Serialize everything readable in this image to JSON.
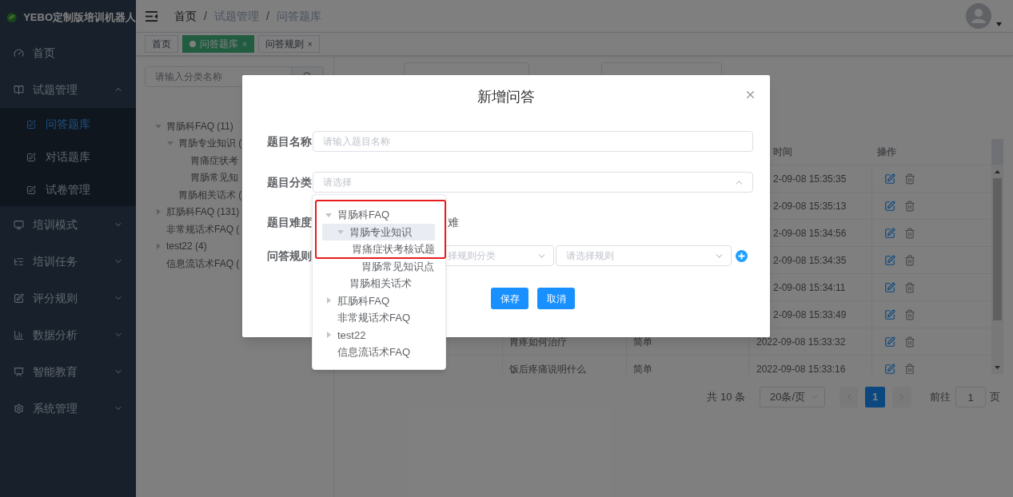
{
  "sidebar": {
    "title": "YEBO定制版培训机器人",
    "items": [
      {
        "label": "首页",
        "kind": "link",
        "selected": false
      },
      {
        "label": "试题管理",
        "kind": "group",
        "selected": false,
        "expanded": true,
        "children": [
          {
            "label": "问答题库",
            "selected": true
          },
          {
            "label": "对话题库",
            "selected": false
          },
          {
            "label": "试卷管理",
            "selected": false
          }
        ]
      },
      {
        "label": "培训模式",
        "kind": "group",
        "selected": false,
        "expanded": false
      },
      {
        "label": "培训任务",
        "kind": "group",
        "selected": false,
        "expanded": false
      },
      {
        "label": "评分规则",
        "kind": "group",
        "selected": false,
        "expanded": false
      },
      {
        "label": "数据分析",
        "kind": "group",
        "selected": false,
        "expanded": false
      },
      {
        "label": "智能教育",
        "kind": "group",
        "selected": false,
        "expanded": false
      },
      {
        "label": "系统管理",
        "kind": "group",
        "selected": false,
        "expanded": false
      }
    ]
  },
  "navbar": {
    "breadcrumb": [
      "首页",
      "试题管理",
      "问答题库"
    ],
    "separator": "/"
  },
  "tags": [
    {
      "label": "首页",
      "selected": false
    },
    {
      "label": "问答题库",
      "selected": true,
      "close_mark": "×"
    },
    {
      "label": "问答规则",
      "selected": false,
      "close_mark": "×"
    }
  ],
  "category_panel": {
    "search_placeholder": "请输入分类名称",
    "tree": [
      {
        "label": "胃肠科FAQ (11)",
        "expanded": true,
        "children": [
          {
            "label": "胃肠专业知识 (",
            "expanded": true,
            "children": [
              {
                "label": "胃痛症状考"
              },
              {
                "label": "胃肠常见知"
              }
            ]
          },
          {
            "label": "胃肠相关话术 ("
          }
        ]
      },
      {
        "label": "肛肠科FAQ (131)",
        "expanded": false
      },
      {
        "label": "非常规话术FAQ ("
      },
      {
        "label": "test22 (4)",
        "expanded": false
      },
      {
        "label": "信息流话术FAQ ("
      }
    ]
  },
  "table": {
    "columns": [
      "时间",
      "操作"
    ],
    "rows": [
      {
        "created": "2-09-08 15:35:35"
      },
      {
        "created": "2-09-08 15:35:13"
      },
      {
        "created": "2-09-08 15:34:56"
      },
      {
        "created": "2-09-08 15:34:35"
      },
      {
        "created": "2-09-08 15:34:11"
      },
      {
        "created": "2-09-08 15:33:49"
      },
      {
        "title": "胃疼如何治疗",
        "difficulty": "简单",
        "created": "2022-09-08 15:33:32"
      },
      {
        "title": "饭后疼痛说明什么",
        "difficulty": "简单",
        "created": "2022-09-08 15:33:16"
      }
    ]
  },
  "pagination": {
    "total": "共 10 条",
    "page_size": "20条/页",
    "pages": [
      {
        "label": "1",
        "selected": true
      }
    ],
    "goto_label": "前往",
    "goto_value": "1",
    "page_suffix": "页"
  },
  "dialog": {
    "title": "新增问答",
    "fields": [
      {
        "label": "题目名称",
        "kind": "input",
        "placeholder": "请输入题目名称"
      },
      {
        "label": "题目分类",
        "kind": "select",
        "placeholder": "请选择",
        "open": true
      },
      {
        "label": "题目难度",
        "kind": "radio",
        "options": [
          {
            "label": "难"
          }
        ]
      },
      {
        "label": "问答规则",
        "kind": "rules",
        "selects": [
          {
            "placeholder": "择规则分类"
          },
          {
            "placeholder": "请选择规则"
          }
        ]
      }
    ],
    "buttons": [
      {
        "label": "保存"
      },
      {
        "label": "取消"
      }
    ]
  },
  "category_dropdown": {
    "items": [
      {
        "label": "胃肠科FAQ",
        "expanded": true,
        "highlighted": false,
        "children": [
          {
            "label": "胃肠专业知识",
            "expanded": true,
            "highlighted": true,
            "children": [
              {
                "label": "胃痛症状考核试题",
                "highlighted": false
              },
              {
                "label": "胃肠常见知识点",
                "highlighted": false
              }
            ]
          },
          {
            "label": "胃肠相关话术",
            "highlighted": false
          }
        ]
      },
      {
        "label": "肛肠科FAQ",
        "expanded": false,
        "highlighted": false
      },
      {
        "label": "非常规话术FAQ",
        "highlighted": false
      },
      {
        "label": "test22",
        "expanded": false,
        "highlighted": false
      },
      {
        "label": "信息流话术FAQ",
        "highlighted": false
      }
    ]
  }
}
